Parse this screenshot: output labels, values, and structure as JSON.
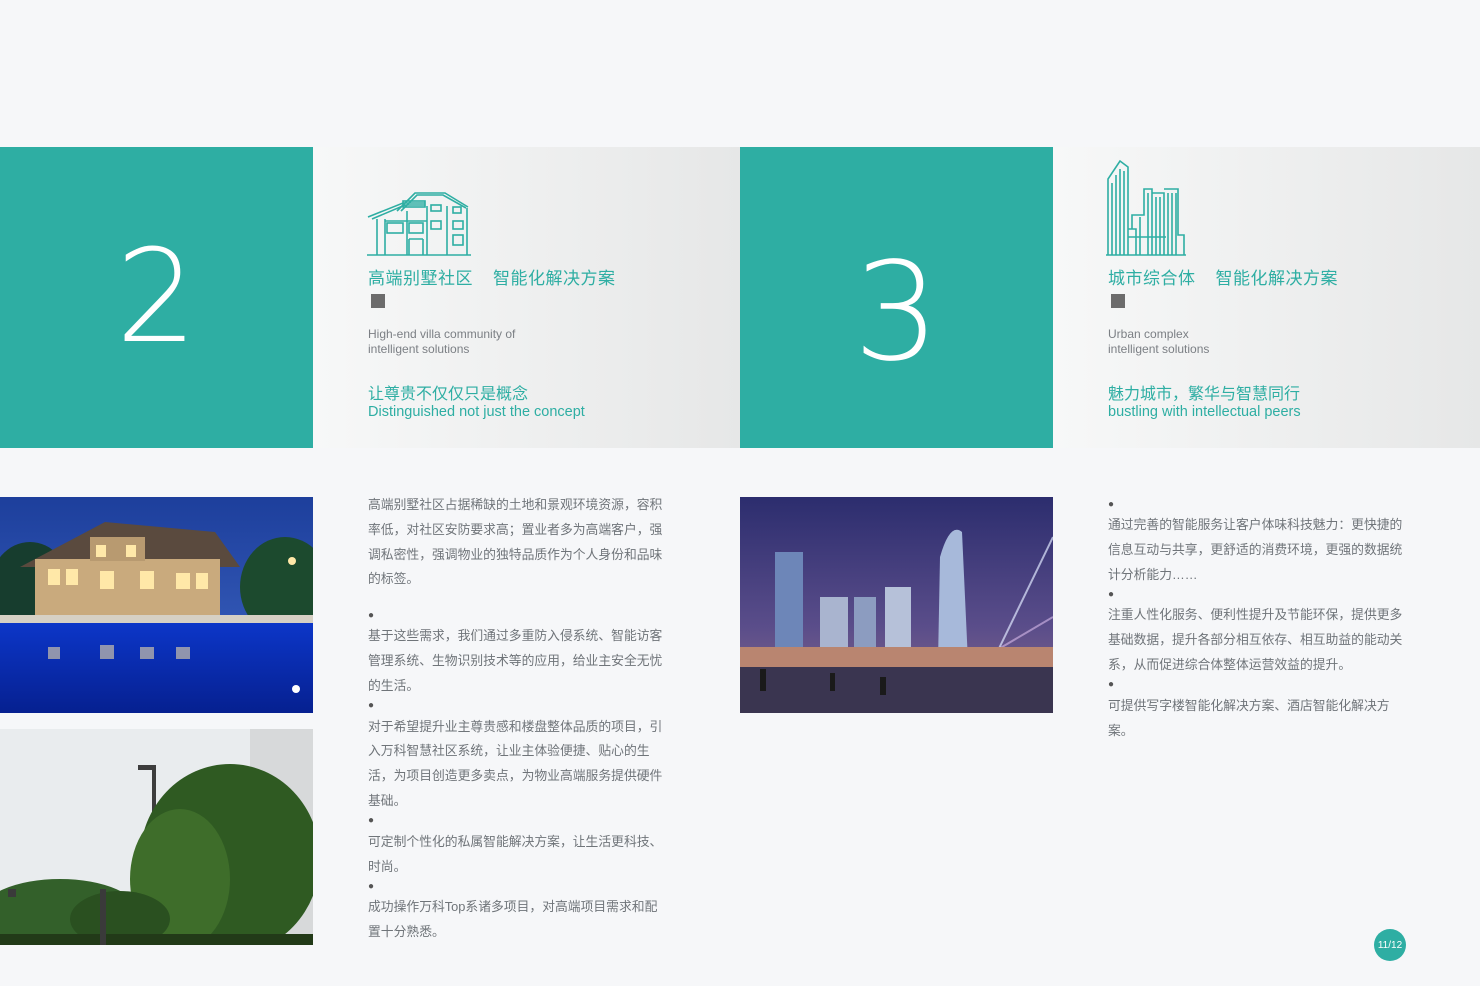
{
  "sections": [
    {
      "number": "2",
      "icon": "villa-line-icon",
      "title_cn_1": "高端别墅社区",
      "title_cn_2": "智能化解决方案",
      "subtitle_en_1": "High-end villa community of",
      "subtitle_en_2": "intelligent solutions",
      "slogan_cn": "让尊贵不仅仅只是概念",
      "slogan_en": "Distinguished not just the concept"
    },
    {
      "number": "3",
      "icon": "skyscraper-line-icon",
      "title_cn_1": "城市综合体",
      "title_cn_2": "智能化解决方案",
      "subtitle_en_1": "Urban complex",
      "subtitle_en_2": "intelligent solutions",
      "slogan_cn": "魅力城市，繁华与智慧同行",
      "slogan_en": "bustling with intellectual peers"
    }
  ],
  "villa_text": {
    "intro": "高端别墅社区占据稀缺的土地和景观环境资源，容积率低，对社区安防要求高；置业者多为高端客户，强调私密性，强调物业的独特品质作为个人身份和品味的标签。",
    "bullet": "●",
    "points": [
      "基于这些需求，我们通过多重防入侵系统、智能访客管理系统、生物识别技术等的应用，给业主安全无忧的生活。",
      "对于希望提升业主尊贵感和楼盘整体品质的项目，引入万科智慧社区系统，让业主体验便捷、贴心的生活，为项目创造更多卖点，为物业高端服务提供硬件基础。",
      "可定制个性化的私属智能解决方案，让生活更科技、时尚。",
      "成功操作万科Top系诸多项目，对高端项目需求和配置十分熟悉。"
    ]
  },
  "urban_text": {
    "bullet": "●",
    "points": [
      "通过完善的智能服务让客户体味科技魅力：更快捷的信息互动与共享，更舒适的消费环境，更强的数据统计分析能力……",
      "注重人性化服务、便利性提升及节能环保，提供更多基础数据，提升各部分相互依存、相互助益的能动关系，从而促进综合体整体运营效益的提升。",
      "可提供写字楼智能化解决方案、酒店智能化解决方案。"
    ]
  },
  "images": {
    "villa_night": "villa-pool-night-photo",
    "bamboo": "bamboo-garden-photo",
    "city": "city-skyline-night-photo"
  },
  "page_indicator": "11/12",
  "colors": {
    "accent": "#2eaea3",
    "text": "#6f7479",
    "background": "#f6f7f9"
  }
}
